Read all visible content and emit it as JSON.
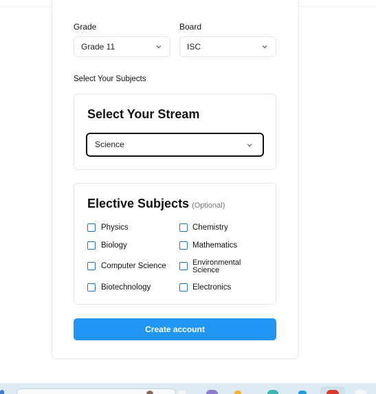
{
  "form": {
    "grade": {
      "label": "Grade",
      "value": "Grade 11"
    },
    "board": {
      "label": "Board",
      "value": "ISC"
    },
    "subjects_heading": "Select Your Subjects",
    "stream": {
      "title": "Select Your Stream",
      "value": "Science"
    },
    "electives": {
      "title": "Elective Subjects",
      "optional_note": "(Optional)",
      "items": [
        {
          "label": "Physics",
          "checked": false
        },
        {
          "label": "Chemistry",
          "checked": false
        },
        {
          "label": "Biology",
          "checked": false
        },
        {
          "label": "Mathematics",
          "checked": false
        },
        {
          "label": "Computer Science",
          "checked": false
        },
        {
          "label": "Environmental",
          "label2": "Science",
          "checked": false
        },
        {
          "label": "Biotechnology",
          "checked": false
        },
        {
          "label": "Electronics",
          "checked": false
        }
      ]
    },
    "submit_label": "Create account"
  },
  "colors": {
    "accent": "#2196f3",
    "checkbox_border": "#1a73c8",
    "focus_border": "#111111"
  },
  "icons": {
    "dropdown": "chevron-down-icon"
  }
}
